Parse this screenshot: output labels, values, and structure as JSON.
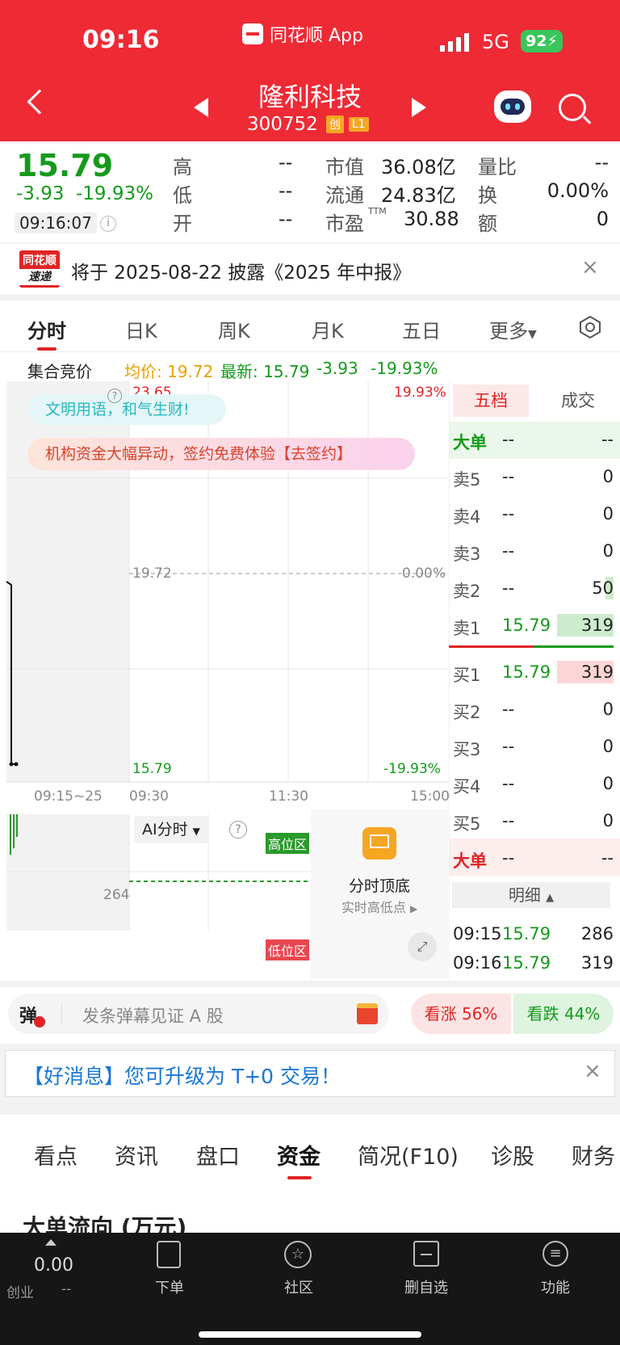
{
  "status_bar": {
    "time": "09:16",
    "app_name": "同花顺 App",
    "network": "5G",
    "battery": "92"
  },
  "header": {
    "stock_name": "隆利科技",
    "stock_code": "300752",
    "badge_chuang": "创",
    "badge_level": "L1"
  },
  "quote": {
    "price": "15.79",
    "change": "-3.93",
    "change_pct": "-19.93%",
    "time": "09:16:07",
    "high_label": "高",
    "high_value": "--",
    "low_label": "低",
    "low_value": "--",
    "open_label": "开",
    "open_value": "--",
    "mktcap_label": "市值",
    "mktcap_value": "36.08亿",
    "float_label": "流通",
    "float_value": "24.83亿",
    "pe_label": "市盈",
    "pe_sup": "TTM",
    "pe_value": "30.88",
    "vol_ratio_label": "量比",
    "vol_ratio_value": "--",
    "turnover_label": "换",
    "turnover_value": "0.00%",
    "amount_label": "额",
    "amount_value": "0"
  },
  "notice": {
    "logo_line1": "同花顺",
    "logo_line2": "速递",
    "text": "将于 2025-08-22 披露《2025 年中报》"
  },
  "chart_tabs": [
    "分时",
    "日K",
    "周K",
    "月K",
    "五日",
    "更多"
  ],
  "chart_info": {
    "label": "集合竞价",
    "avg": "均价: 19.72",
    "latest": "最新: 15.79",
    "change": "-3.93",
    "change_pct": "-19.93%"
  },
  "chart": {
    "top_price": "23.65",
    "top_pct": "19.93%",
    "mid_price": "19.72",
    "mid_pct": "0.00%",
    "bottom_price": "15.79",
    "bottom_pct": "-19.93%",
    "time_labels": [
      "09:15~25",
      "09:30",
      "11:30",
      "15:00"
    ],
    "chat_tip": "文明用语，和气生财!",
    "promo": "机构资金大幅异动，签约免费体验【去签约】",
    "ai_label": "AI分时",
    "vol_label": "264",
    "high_zone": "高位区",
    "low_zone": "低位区",
    "feature_title": "分时顶底",
    "feature_sub": "实时高低点"
  },
  "orderbook": {
    "tabs": [
      "五档",
      "成交"
    ],
    "big_label": "大单",
    "big_value1": "--",
    "big_value2": "--",
    "asks": [
      {
        "label": "卖5",
        "price": "--",
        "vol": "0"
      },
      {
        "label": "卖4",
        "price": "--",
        "vol": "0"
      },
      {
        "label": "卖3",
        "price": "--",
        "vol": "0"
      },
      {
        "label": "卖2",
        "price": "--",
        "vol": "50"
      },
      {
        "label": "卖1",
        "price": "15.79",
        "vol": "319"
      }
    ],
    "bids": [
      {
        "label": "买1",
        "price": "15.79",
        "vol": "319"
      },
      {
        "label": "买2",
        "price": "--",
        "vol": "0"
      },
      {
        "label": "买3",
        "price": "--",
        "vol": "0"
      },
      {
        "label": "买4",
        "price": "--",
        "vol": "0"
      },
      {
        "label": "买5",
        "price": "--",
        "vol": "0"
      }
    ],
    "big2_label": "大单",
    "big2_value1": "--",
    "big2_value2": "--",
    "detail_label": "明细",
    "trades": [
      {
        "time": "09:15",
        "price": "15.79",
        "vol": "286"
      },
      {
        "time": "09:16",
        "price": "15.79",
        "vol": "319"
      }
    ]
  },
  "danmu": {
    "icon": "弹",
    "placeholder": "发条弹幕见证 A 股",
    "rise": "看涨 56%",
    "fall": "看跌 44%"
  },
  "good_news": {
    "text": "【好消息】您可升级为 T+0 交易！"
  },
  "section_tabs": [
    "看点",
    "资讯",
    "盘口",
    "资金",
    "简况(F10)",
    "诊股",
    "财务"
  ],
  "section_title": "大单流向 (万元)",
  "bottom": {
    "index_value": "0.00",
    "index_name": "创业",
    "index_change": "--",
    "items": [
      "下单",
      "社区",
      "删自选",
      "功能"
    ]
  }
}
